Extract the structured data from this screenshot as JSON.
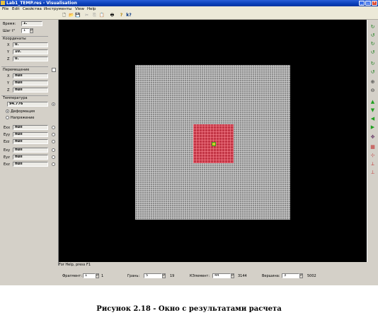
{
  "window": {
    "title": "Lab1_TEMP.res - Visualisation",
    "controls": {
      "minimize": "_",
      "maximize": "□",
      "close": "×"
    }
  },
  "menu": [
    "File",
    "Edit",
    "Свойства",
    "Инструменты",
    "View",
    "Help"
  ],
  "toolbar": [
    {
      "icon": "new-doc-icon",
      "glyph": "🗋"
    },
    {
      "icon": "open-folder-icon",
      "glyph": "📂"
    },
    {
      "icon": "save-icon",
      "glyph": "💾"
    },
    {
      "icon": "cut-icon",
      "glyph": "✂"
    },
    {
      "icon": "copy-icon",
      "glyph": "⎘"
    },
    {
      "icon": "paste-icon",
      "glyph": "📋"
    },
    {
      "icon": "print-icon",
      "glyph": "🖶"
    },
    {
      "icon": "help-icon",
      "glyph": "?"
    },
    {
      "icon": "context-help-icon",
      "glyph": "k?"
    }
  ],
  "left": {
    "time_label": "Время:",
    "time_value": "1.",
    "step_label": "Шаг t°",
    "step_value": "1",
    "coords_label": "Координаты",
    "x_label": "X",
    "x_value": "0.",
    "y_label": "Y",
    "y_value": "10.",
    "z_label": "Z",
    "z_value": "0.",
    "disp_label": "Перемещение",
    "dx_value": "null",
    "dy_value": "null",
    "dz_value": "null",
    "temp_label": "Температура",
    "temp_value": "94.776",
    "deform_label": "Деформация",
    "stress_label": "Напряжение",
    "exx_label": "Exx",
    "eyy_label": "Eyy",
    "ezz_label": "Ezz",
    "exy_label": "Exy",
    "eyz_label": "Eyz",
    "exz_label": "Exz",
    "null": "null"
  },
  "status": {
    "help": "For Help, press F1"
  },
  "bottom": {
    "fragment_label": "Фрагмент:",
    "fragment_value": "1",
    "fragment_total": "1",
    "face_label": "Грань:",
    "face_value": "5",
    "face_total": "19",
    "element_label": "КЭлемент:",
    "element_value": "44",
    "element_total": "3144",
    "vertex_label": "Вершина:",
    "vertex_value": "3",
    "vertex_total": "5002"
  },
  "caption": "Рисунок 2.18 - Окно с результатами расчета",
  "colors": {
    "titlebar": "#0a3fb8",
    "viewport": "#000000",
    "mesh": "#8c8c8c",
    "hot_region": "#c23545",
    "core": "#c8d020"
  }
}
